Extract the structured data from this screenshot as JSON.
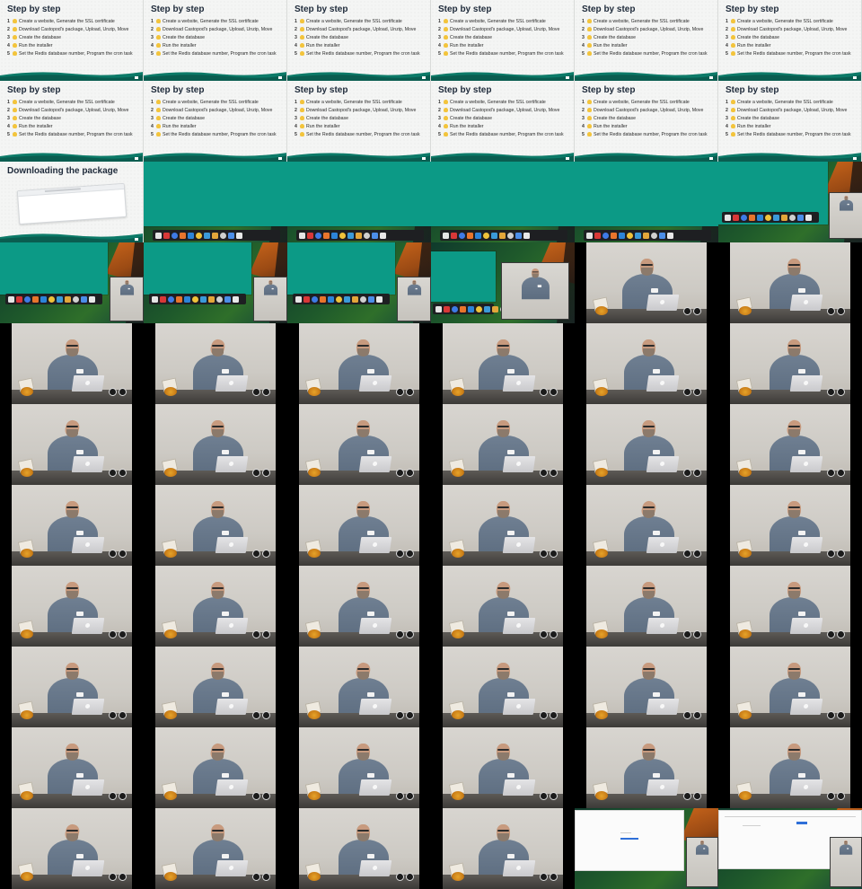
{
  "slides": {
    "title": "Step by step",
    "steps": [
      {
        "num": "1",
        "text": "Create a website, Generate the SSL certificate"
      },
      {
        "num": "2",
        "text": "Download Castopod's package, Upload, Unzip, Move"
      },
      {
        "num": "3",
        "text": "Create the database"
      },
      {
        "num": "4",
        "text": "Run the installer"
      },
      {
        "num": "5",
        "text": "Set the Redis database number, Program the cron task"
      }
    ],
    "download_title": "Downloading the package"
  },
  "colors": {
    "slide_background": "#f4f5f4",
    "brand_teal": "#0c7a68",
    "window_teal": "#0c9a86",
    "dock": "#1e1f22"
  },
  "dock_icons": [
    "camera-icon",
    "video-recorder-icon",
    "firefox-icon",
    "chrome-icon",
    "thunderbird-icon",
    "notes-icon",
    "image-viewer-icon",
    "files-icon",
    "terminal-icon",
    "settings-icon",
    "media-icon"
  ]
}
